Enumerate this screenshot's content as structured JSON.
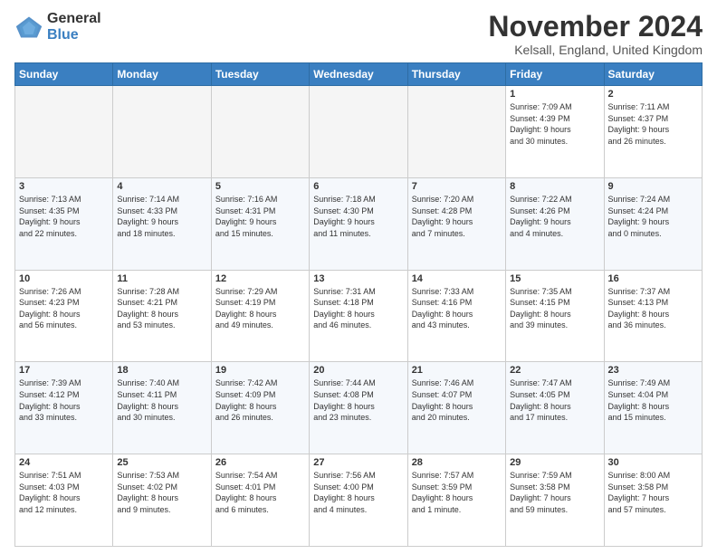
{
  "logo": {
    "general": "General",
    "blue": "Blue"
  },
  "header": {
    "month": "November 2024",
    "location": "Kelsall, England, United Kingdom"
  },
  "days_of_week": [
    "Sunday",
    "Monday",
    "Tuesday",
    "Wednesday",
    "Thursday",
    "Friday",
    "Saturday"
  ],
  "weeks": [
    [
      {
        "day": "",
        "info": "",
        "empty": true
      },
      {
        "day": "",
        "info": "",
        "empty": true
      },
      {
        "day": "",
        "info": "",
        "empty": true
      },
      {
        "day": "",
        "info": "",
        "empty": true
      },
      {
        "day": "",
        "info": "",
        "empty": true
      },
      {
        "day": "1",
        "info": "Sunrise: 7:09 AM\nSunset: 4:39 PM\nDaylight: 9 hours\nand 30 minutes."
      },
      {
        "day": "2",
        "info": "Sunrise: 7:11 AM\nSunset: 4:37 PM\nDaylight: 9 hours\nand 26 minutes."
      }
    ],
    [
      {
        "day": "3",
        "info": "Sunrise: 7:13 AM\nSunset: 4:35 PM\nDaylight: 9 hours\nand 22 minutes."
      },
      {
        "day": "4",
        "info": "Sunrise: 7:14 AM\nSunset: 4:33 PM\nDaylight: 9 hours\nand 18 minutes."
      },
      {
        "day": "5",
        "info": "Sunrise: 7:16 AM\nSunset: 4:31 PM\nDaylight: 9 hours\nand 15 minutes."
      },
      {
        "day": "6",
        "info": "Sunrise: 7:18 AM\nSunset: 4:30 PM\nDaylight: 9 hours\nand 11 minutes."
      },
      {
        "day": "7",
        "info": "Sunrise: 7:20 AM\nSunset: 4:28 PM\nDaylight: 9 hours\nand 7 minutes."
      },
      {
        "day": "8",
        "info": "Sunrise: 7:22 AM\nSunset: 4:26 PM\nDaylight: 9 hours\nand 4 minutes."
      },
      {
        "day": "9",
        "info": "Sunrise: 7:24 AM\nSunset: 4:24 PM\nDaylight: 9 hours\nand 0 minutes."
      }
    ],
    [
      {
        "day": "10",
        "info": "Sunrise: 7:26 AM\nSunset: 4:23 PM\nDaylight: 8 hours\nand 56 minutes."
      },
      {
        "day": "11",
        "info": "Sunrise: 7:28 AM\nSunset: 4:21 PM\nDaylight: 8 hours\nand 53 minutes."
      },
      {
        "day": "12",
        "info": "Sunrise: 7:29 AM\nSunset: 4:19 PM\nDaylight: 8 hours\nand 49 minutes."
      },
      {
        "day": "13",
        "info": "Sunrise: 7:31 AM\nSunset: 4:18 PM\nDaylight: 8 hours\nand 46 minutes."
      },
      {
        "day": "14",
        "info": "Sunrise: 7:33 AM\nSunset: 4:16 PM\nDaylight: 8 hours\nand 43 minutes."
      },
      {
        "day": "15",
        "info": "Sunrise: 7:35 AM\nSunset: 4:15 PM\nDaylight: 8 hours\nand 39 minutes."
      },
      {
        "day": "16",
        "info": "Sunrise: 7:37 AM\nSunset: 4:13 PM\nDaylight: 8 hours\nand 36 minutes."
      }
    ],
    [
      {
        "day": "17",
        "info": "Sunrise: 7:39 AM\nSunset: 4:12 PM\nDaylight: 8 hours\nand 33 minutes."
      },
      {
        "day": "18",
        "info": "Sunrise: 7:40 AM\nSunset: 4:11 PM\nDaylight: 8 hours\nand 30 minutes."
      },
      {
        "day": "19",
        "info": "Sunrise: 7:42 AM\nSunset: 4:09 PM\nDaylight: 8 hours\nand 26 minutes."
      },
      {
        "day": "20",
        "info": "Sunrise: 7:44 AM\nSunset: 4:08 PM\nDaylight: 8 hours\nand 23 minutes."
      },
      {
        "day": "21",
        "info": "Sunrise: 7:46 AM\nSunset: 4:07 PM\nDaylight: 8 hours\nand 20 minutes."
      },
      {
        "day": "22",
        "info": "Sunrise: 7:47 AM\nSunset: 4:05 PM\nDaylight: 8 hours\nand 17 minutes."
      },
      {
        "day": "23",
        "info": "Sunrise: 7:49 AM\nSunset: 4:04 PM\nDaylight: 8 hours\nand 15 minutes."
      }
    ],
    [
      {
        "day": "24",
        "info": "Sunrise: 7:51 AM\nSunset: 4:03 PM\nDaylight: 8 hours\nand 12 minutes."
      },
      {
        "day": "25",
        "info": "Sunrise: 7:53 AM\nSunset: 4:02 PM\nDaylight: 8 hours\nand 9 minutes."
      },
      {
        "day": "26",
        "info": "Sunrise: 7:54 AM\nSunset: 4:01 PM\nDaylight: 8 hours\nand 6 minutes."
      },
      {
        "day": "27",
        "info": "Sunrise: 7:56 AM\nSunset: 4:00 PM\nDaylight: 8 hours\nand 4 minutes."
      },
      {
        "day": "28",
        "info": "Sunrise: 7:57 AM\nSunset: 3:59 PM\nDaylight: 8 hours\nand 1 minute."
      },
      {
        "day": "29",
        "info": "Sunrise: 7:59 AM\nSunset: 3:58 PM\nDaylight: 7 hours\nand 59 minutes."
      },
      {
        "day": "30",
        "info": "Sunrise: 8:00 AM\nSunset: 3:58 PM\nDaylight: 7 hours\nand 57 minutes."
      }
    ]
  ]
}
